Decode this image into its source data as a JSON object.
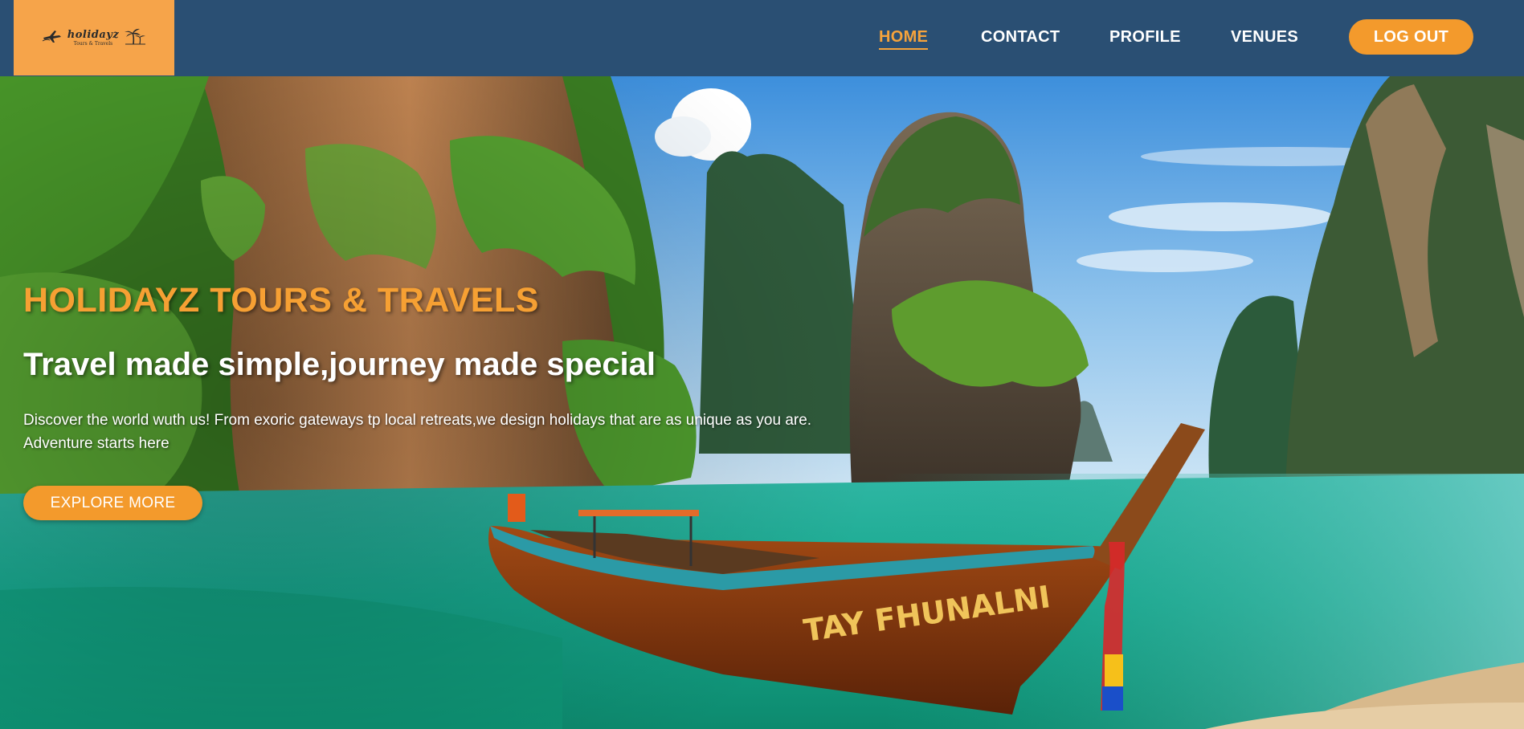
{
  "brand": {
    "name": "holidayz",
    "tagline": "Tours & Travels"
  },
  "nav": {
    "items": [
      {
        "label": "HOME",
        "active": true
      },
      {
        "label": "CONTACT",
        "active": false
      },
      {
        "label": "PROFILE",
        "active": false
      },
      {
        "label": "VENUES",
        "active": false
      }
    ],
    "logout_label": "LOG OUT"
  },
  "hero": {
    "title": "HOLIDAYZ TOURS & TRAVELS",
    "subtitle": "Travel made simple,journey made special",
    "description": "Discover the world wuth us! From exoric gateways tp local retreats,we design holidays that are as unique as you are. Adventure starts here",
    "cta_label": "EXPLORE MORE",
    "boat_text": "TAY FHUNALNI"
  },
  "colors": {
    "nav_bg": "#2a4f73",
    "accent": "#f39a2c",
    "logo_bg": "#f6a44a",
    "text_light": "#ffffff"
  },
  "icons": {
    "logo_left": "airplane-icon",
    "logo_right": "palm-tree-icon"
  }
}
